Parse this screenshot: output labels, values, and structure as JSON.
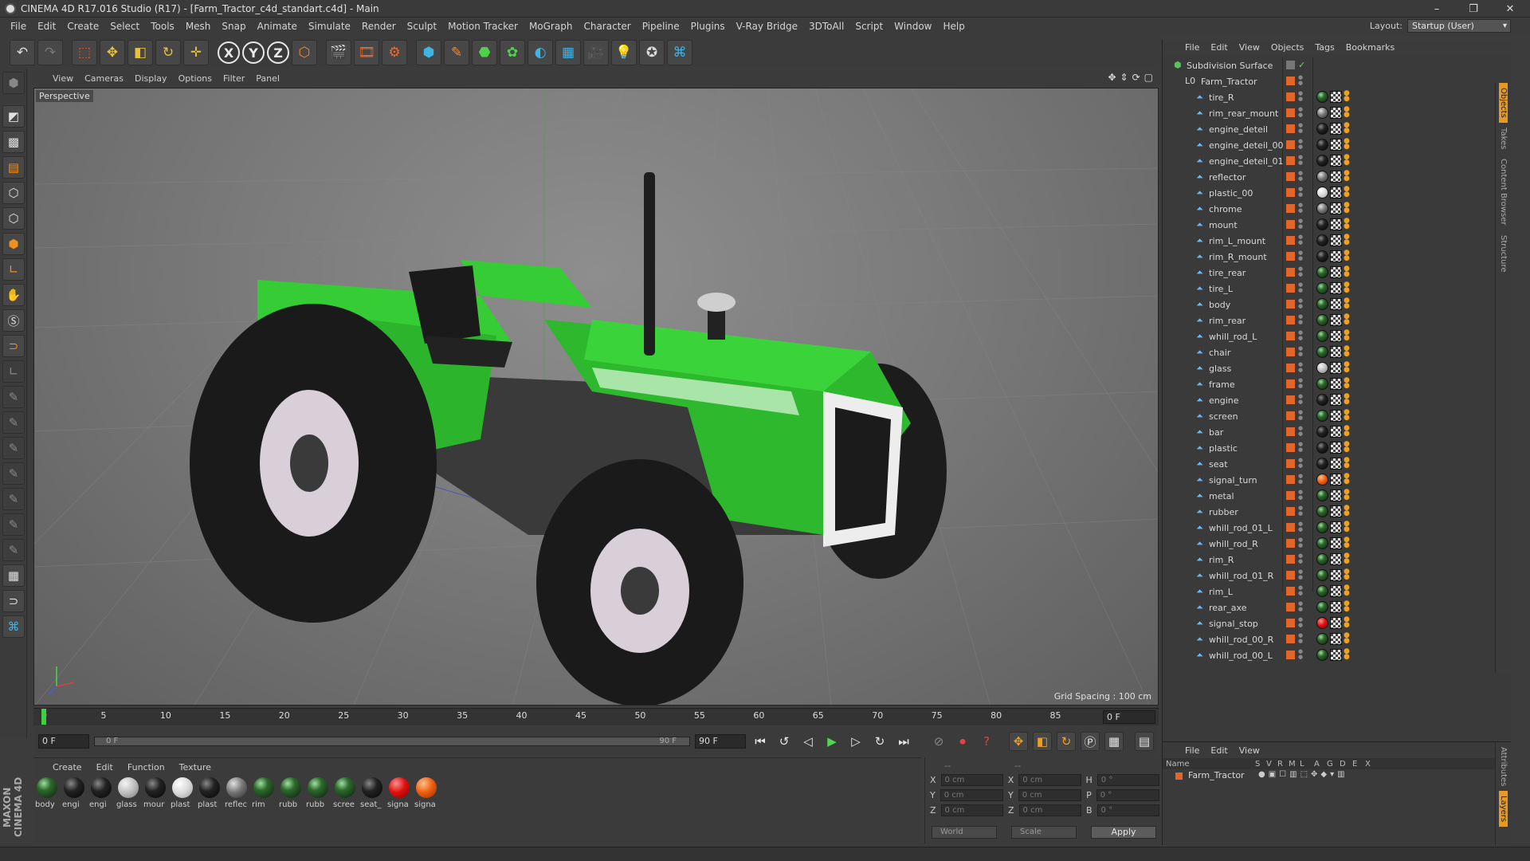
{
  "window": {
    "title": "CINEMA 4D R17.016 Studio (R17) - [Farm_Tractor_c4d_standart.c4d] - Main",
    "minimize": "–",
    "maximize": "❐",
    "close": "✕"
  },
  "menu": [
    "File",
    "Edit",
    "Create",
    "Select",
    "Tools",
    "Mesh",
    "Snap",
    "Animate",
    "Simulate",
    "Render",
    "Sculpt",
    "Motion Tracker",
    "MoGraph",
    "Character",
    "Pipeline",
    "Plugins",
    "V-Ray Bridge",
    "3DToAll",
    "Script",
    "Window",
    "Help"
  ],
  "layout": {
    "label": "Layout:",
    "value": "Startup (User)"
  },
  "viewport": {
    "menu": [
      "View",
      "Cameras",
      "Display",
      "Options",
      "Filter",
      "Panel"
    ],
    "label": "Perspective",
    "grid_spacing": "Grid Spacing : 100 cm"
  },
  "timeline": {
    "ticks": [
      "0",
      "5",
      "10",
      "15",
      "20",
      "25",
      "30",
      "35",
      "40",
      "45",
      "50",
      "55",
      "60",
      "65",
      "70",
      "75",
      "80",
      "85",
      "90"
    ],
    "current_frame": "0 F",
    "start_field": "0 F",
    "range_start": "0 F",
    "range_end": "90 F",
    "end_field": "90 F"
  },
  "materials": {
    "menu": [
      "Create",
      "Edit",
      "Function",
      "Texture"
    ],
    "items": [
      {
        "label": "body",
        "kind": "green"
      },
      {
        "label": "engi",
        "kind": "black"
      },
      {
        "label": "engi",
        "kind": "black"
      },
      {
        "label": "glass",
        "kind": "glass"
      },
      {
        "label": "mour",
        "kind": "black"
      },
      {
        "label": "plast",
        "kind": "white"
      },
      {
        "label": "plast",
        "kind": "black"
      },
      {
        "label": "reflec",
        "kind": "grey"
      },
      {
        "label": "rim",
        "kind": "green"
      },
      {
        "label": "rubb",
        "kind": "green"
      },
      {
        "label": "rubb",
        "kind": "green"
      },
      {
        "label": "scree",
        "kind": "green"
      },
      {
        "label": "seat_",
        "kind": "black"
      },
      {
        "label": "signa",
        "kind": "red"
      },
      {
        "label": "signa",
        "kind": "orange"
      }
    ]
  },
  "coords": {
    "rows": [
      {
        "a": "X",
        "av": "0 cm",
        "b": "X",
        "bv": "0 cm",
        "c": "H",
        "cv": "0 °"
      },
      {
        "a": "Y",
        "av": "0 cm",
        "b": "Y",
        "bv": "0 cm",
        "c": "P",
        "cv": "0 °"
      },
      {
        "a": "Z",
        "av": "0 cm",
        "b": "Z",
        "bv": "0 cm",
        "c": "B",
        "cv": "0 °"
      }
    ],
    "header_a": "--",
    "header_b": "--",
    "world": "World",
    "scale": "Scale",
    "apply": "Apply"
  },
  "objects_panel": {
    "menu": [
      "File",
      "Edit",
      "View",
      "Objects",
      "Tags",
      "Bookmarks"
    ],
    "top": "Subdivision Surface",
    "root": "Farm_Tractor",
    "children": [
      "tire_R",
      "rim_rear_mount",
      "engine_deteil",
      "engine_deteil_00",
      "engine_deteil_01",
      "reflector",
      "plastic_00",
      "chrome",
      "mount",
      "rim_L_mount",
      "rim_R_mount",
      "tire_rear",
      "tire_L",
      "body",
      "rim_rear",
      "whill_rod_L",
      "chair",
      "glass",
      "frame",
      "engine",
      "screen",
      "bar",
      "plastic",
      "seat",
      "signal_turn",
      "metal",
      "rubber",
      "whill_rod_01_L",
      "whill_rod_R",
      "rim_R",
      "whill_rod_01_R",
      "rim_L",
      "rear_axe",
      "signal_stop",
      "whill_rod_00_R",
      "whill_rod_00_L"
    ],
    "mat_kinds": [
      "green",
      "grey",
      "black",
      "black",
      "black",
      "grey",
      "white",
      "grey",
      "black",
      "black",
      "black",
      "green",
      "green",
      "green",
      "green",
      "green",
      "green",
      "glass",
      "green",
      "black",
      "green",
      "black",
      "black",
      "black",
      "orange",
      "green",
      "green",
      "green",
      "green",
      "green",
      "green",
      "green",
      "green",
      "red",
      "green",
      "green"
    ],
    "side_tabs": [
      "Objects",
      "Takes",
      "Content Browser",
      "Structure"
    ]
  },
  "attributes_panel": {
    "menu": [
      "File",
      "Edit",
      "View"
    ],
    "columns": [
      "Name",
      "S",
      "V",
      "R",
      "M",
      "L",
      "A",
      "G",
      "D",
      "E",
      "X"
    ],
    "row": "Farm_Tractor",
    "side_tabs": [
      "Attributes",
      "Layers"
    ]
  },
  "brand": "MAXON CINEMA 4D",
  "colors": {
    "accent": "#e0662a",
    "tractor_green": "#2fc42f"
  }
}
